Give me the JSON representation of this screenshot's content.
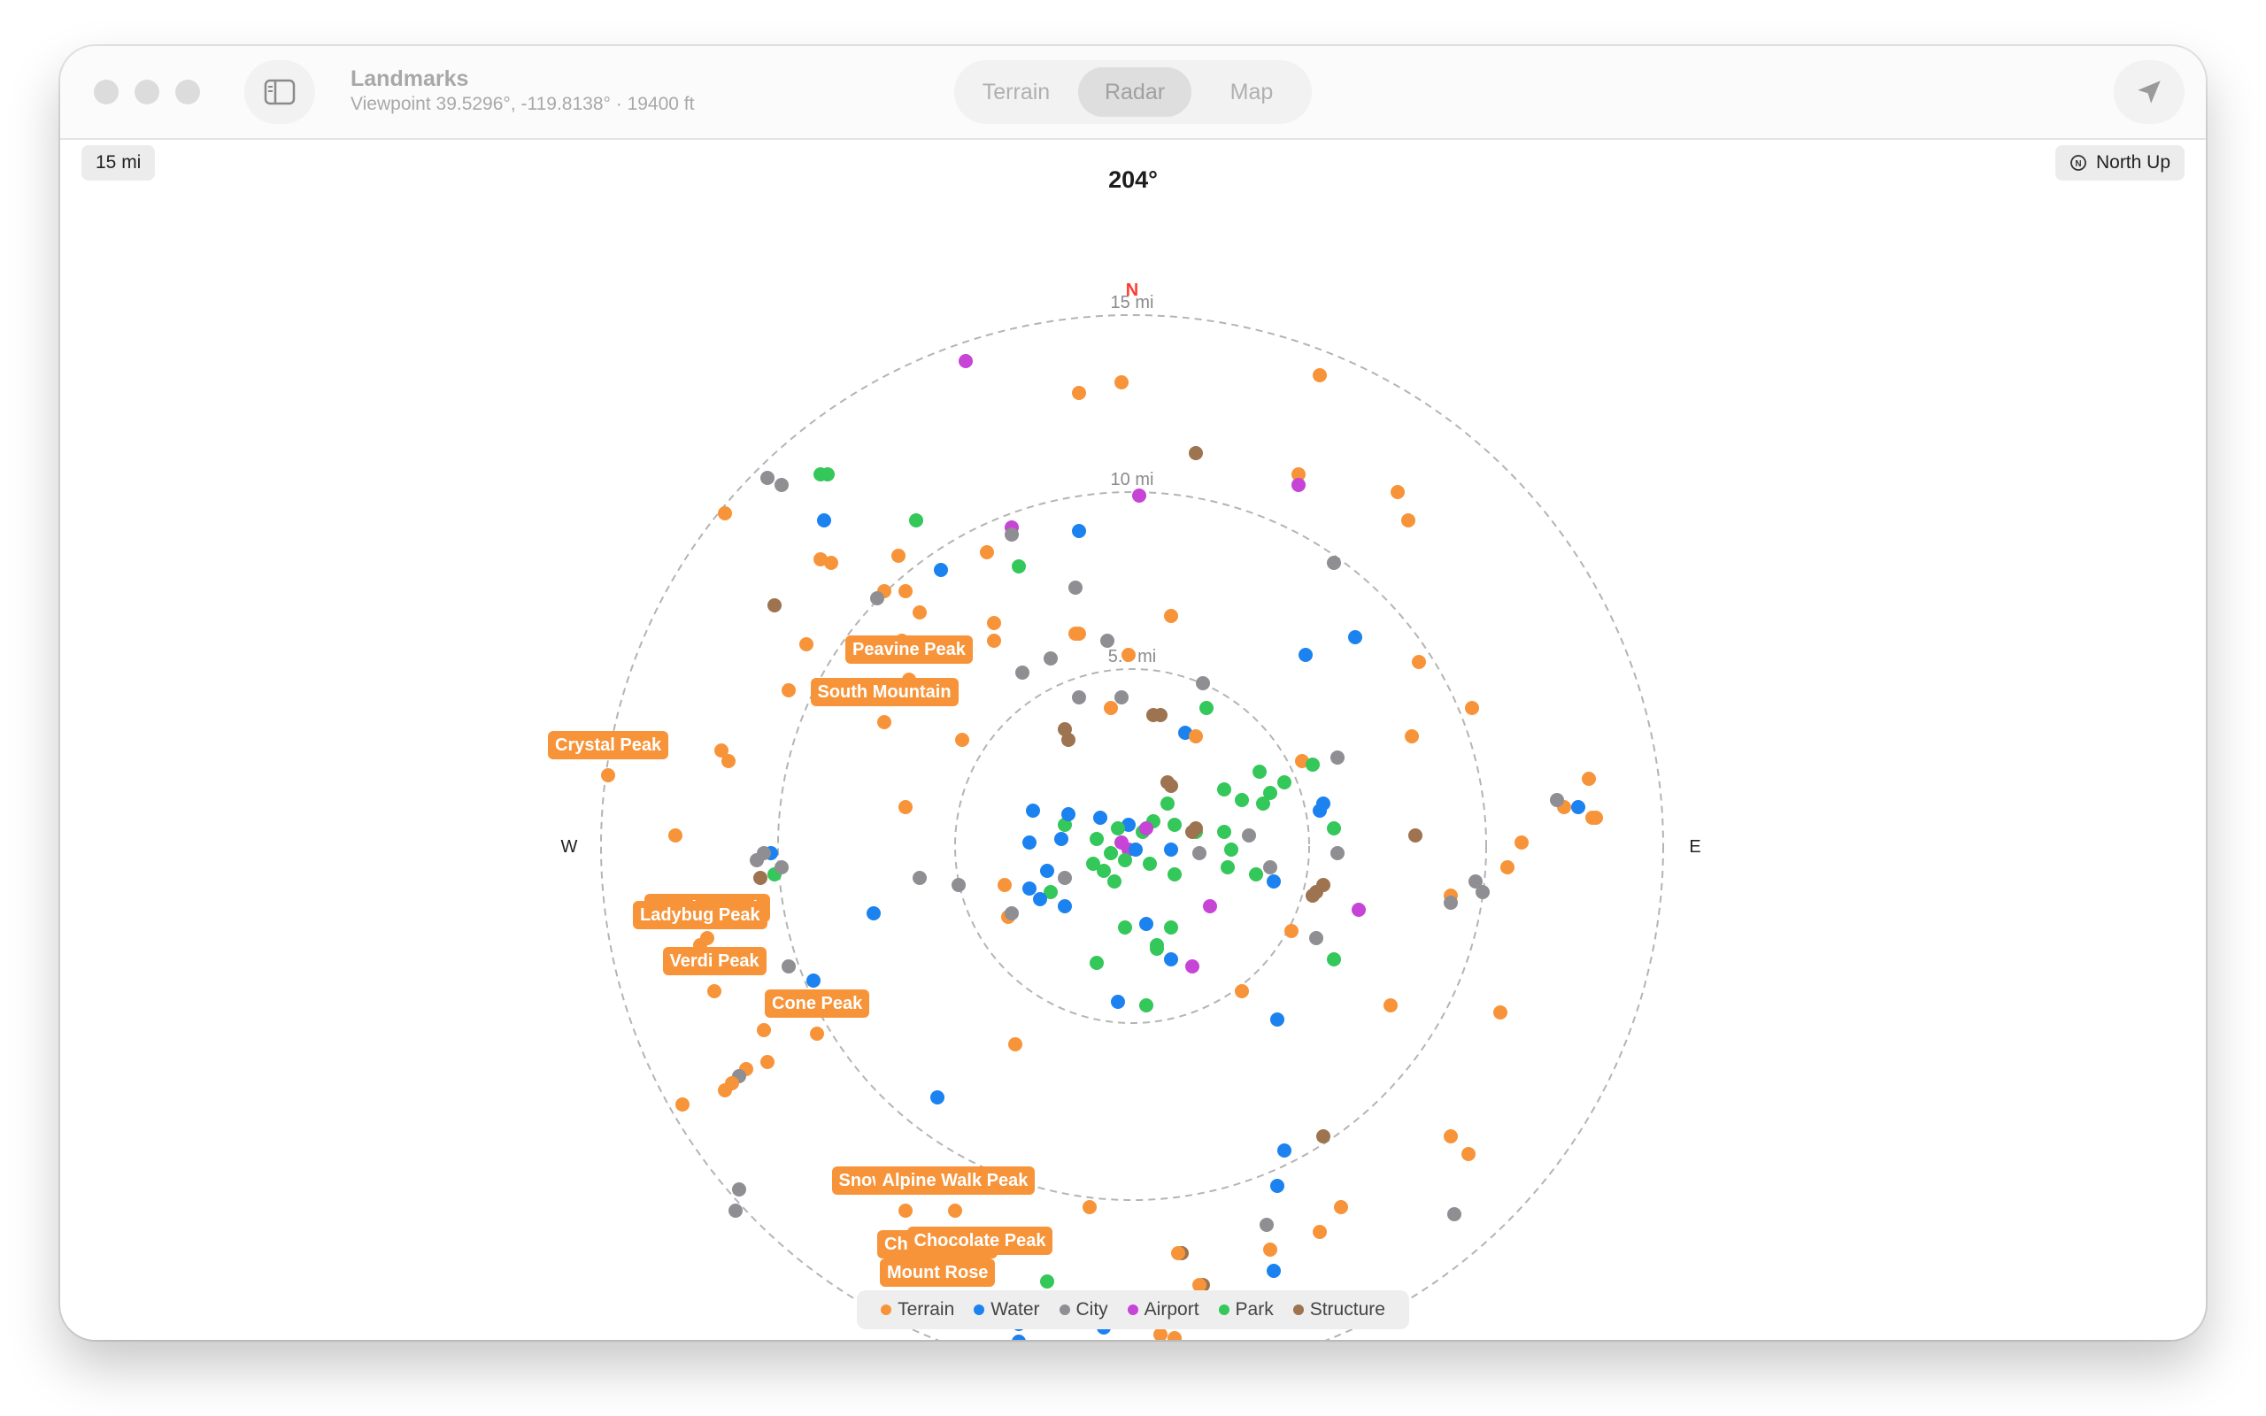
{
  "window": {
    "title": "Landmarks",
    "subtitle": "Viewpoint 39.5296°, -119.8138° · 19400 ft"
  },
  "view_modes": [
    {
      "label": "Terrain",
      "selected": false
    },
    {
      "label": "Radar",
      "selected": true
    },
    {
      "label": "Map",
      "selected": false
    }
  ],
  "toolbar": {
    "scale_label": "15 mi",
    "north_up_label": "North Up",
    "heading_label": "204°"
  },
  "radar": {
    "max_range_mi": 15,
    "rings": [
      {
        "range_mi": 5,
        "label": "5.0 mi"
      },
      {
        "range_mi": 10,
        "label": "10 mi"
      },
      {
        "range_mi": 15,
        "label": "15 mi"
      }
    ],
    "compass": {
      "north": "N",
      "west": "W",
      "east": "E"
    }
  },
  "categories": [
    {
      "key": "terrain",
      "label": "Terrain",
      "color": "#f7943a"
    },
    {
      "key": "water",
      "label": "Water",
      "color": "#1b82f0"
    },
    {
      "key": "city",
      "label": "City",
      "color": "#8e8e93"
    },
    {
      "key": "airport",
      "label": "Airport",
      "color": "#c644d6"
    },
    {
      "key": "park",
      "label": "Park",
      "color": "#34c759"
    },
    {
      "key": "structure",
      "label": "Structure",
      "color": "#9d7350"
    }
  ],
  "landmarks": [
    {
      "name": "Peavine Peak",
      "category": "terrain",
      "e": -6.3,
      "n": 4.7
    },
    {
      "name": "South Mountain",
      "category": "terrain",
      "e": -7.0,
      "n": 3.5
    },
    {
      "name": "Crystal Peak",
      "category": "terrain",
      "e": -14.8,
      "n": 2.0
    },
    {
      "name": "Sunrise Peak",
      "category": "terrain",
      "e": -12.0,
      "n": -2.6
    },
    {
      "name": "Ladybug Peak",
      "category": "terrain",
      "e": -12.2,
      "n": -2.8
    },
    {
      "name": "Verdi Peak",
      "category": "terrain",
      "e": -11.8,
      "n": -4.1
    },
    {
      "name": "Cone Peak",
      "category": "terrain",
      "e": -8.9,
      "n": -5.3
    },
    {
      "name": "Snowflake Peak",
      "category": "terrain",
      "e": -6.4,
      "n": -10.3
    },
    {
      "name": "Alpine Walk Peak",
      "category": "terrain",
      "e": -5.0,
      "n": -10.3
    },
    {
      "name": "Chutes Peak",
      "category": "terrain",
      "e": -5.5,
      "n": -12.1
    },
    {
      "name": "Chocolate Peak",
      "category": "terrain",
      "e": -4.3,
      "n": -12.0
    },
    {
      "name": "Mount Rose",
      "category": "terrain",
      "e": -5.5,
      "n": -12.9
    }
  ],
  "points": [
    {
      "category": "airport",
      "e": -4.7,
      "n": 13.7
    },
    {
      "category": "terrain",
      "e": -1.5,
      "n": 12.8
    },
    {
      "category": "terrain",
      "e": -0.3,
      "n": 13.1
    },
    {
      "category": "terrain",
      "e": 5.3,
      "n": 13.3
    },
    {
      "category": "structure",
      "e": 1.8,
      "n": 11.1
    },
    {
      "category": "city",
      "e": -10.3,
      "n": 10.4
    },
    {
      "category": "city",
      "e": -9.9,
      "n": 10.2
    },
    {
      "category": "park",
      "e": -8.8,
      "n": 10.5
    },
    {
      "category": "park",
      "e": -8.6,
      "n": 10.5
    },
    {
      "category": "terrain",
      "e": -11.5,
      "n": 9.4
    },
    {
      "category": "water",
      "e": -8.7,
      "n": 9.2
    },
    {
      "category": "park",
      "e": -6.1,
      "n": 9.2
    },
    {
      "category": "terrain",
      "e": 4.7,
      "n": 10.5
    },
    {
      "category": "airport",
      "e": 4.7,
      "n": 10.2
    },
    {
      "category": "terrain",
      "e": 7.5,
      "n": 10.0
    },
    {
      "category": "terrain",
      "e": 7.8,
      "n": 9.2
    },
    {
      "category": "airport",
      "e": 0.2,
      "n": 9.9
    },
    {
      "category": "airport",
      "e": -3.4,
      "n": 9.0
    },
    {
      "category": "city",
      "e": -3.4,
      "n": 8.8
    },
    {
      "category": "water",
      "e": -1.5,
      "n": 8.9
    },
    {
      "category": "terrain",
      "e": -8.8,
      "n": 8.1
    },
    {
      "category": "terrain",
      "e": -8.5,
      "n": 8.0
    },
    {
      "category": "terrain",
      "e": -6.6,
      "n": 8.2
    },
    {
      "category": "terrain",
      "e": -4.1,
      "n": 8.3
    },
    {
      "category": "water",
      "e": -5.4,
      "n": 7.8
    },
    {
      "category": "park",
      "e": -3.2,
      "n": 7.9
    },
    {
      "category": "city",
      "e": 5.7,
      "n": 8.0
    },
    {
      "category": "terrain",
      "e": -7.0,
      "n": 7.2
    },
    {
      "category": "city",
      "e": -7.2,
      "n": 7.0
    },
    {
      "category": "terrain",
      "e": -6.4,
      "n": 7.2
    },
    {
      "category": "city",
      "e": -1.6,
      "n": 7.3
    },
    {
      "category": "structure",
      "e": -10.1,
      "n": 6.8
    },
    {
      "category": "terrain",
      "e": -6.0,
      "n": 6.6
    },
    {
      "category": "terrain",
      "e": -3.9,
      "n": 6.3
    },
    {
      "category": "terrain",
      "e": 1.1,
      "n": 6.5
    },
    {
      "category": "terrain",
      "e": -9.2,
      "n": 5.7
    },
    {
      "category": "terrain",
      "e": -6.5,
      "n": 5.8
    },
    {
      "category": "terrain",
      "e": -6.3,
      "n": 5.6
    },
    {
      "category": "terrain",
      "e": -3.9,
      "n": 5.8
    },
    {
      "category": "terrain",
      "e": -1.6,
      "n": 6.0
    },
    {
      "category": "terrain",
      "e": -1.5,
      "n": 6.0
    },
    {
      "category": "city",
      "e": -0.7,
      "n": 5.8
    },
    {
      "category": "water",
      "e": 4.9,
      "n": 5.4
    },
    {
      "category": "water",
      "e": 6.3,
      "n": 5.9
    },
    {
      "category": "terrain",
      "e": 8.1,
      "n": 5.2
    },
    {
      "category": "city",
      "e": -2.3,
      "n": 5.3
    },
    {
      "category": "city",
      "e": -3.1,
      "n": 4.9
    },
    {
      "category": "terrain",
      "e": -0.1,
      "n": 5.4
    },
    {
      "category": "city",
      "e": 2.0,
      "n": 4.6
    },
    {
      "category": "terrain",
      "e": -9.7,
      "n": 4.4
    },
    {
      "category": "city",
      "e": -1.5,
      "n": 4.2
    },
    {
      "category": "city",
      "e": -0.3,
      "n": 4.2
    },
    {
      "category": "terrain",
      "e": -0.6,
      "n": 3.9
    },
    {
      "category": "park",
      "e": 2.1,
      "n": 3.9
    },
    {
      "category": "structure",
      "e": 0.6,
      "n": 3.7
    },
    {
      "category": "structure",
      "e": 0.8,
      "n": 3.7
    },
    {
      "category": "terrain",
      "e": 9.6,
      "n": 3.9
    },
    {
      "category": "structure",
      "e": -1.9,
      "n": 3.3
    },
    {
      "category": "structure",
      "e": -1.8,
      "n": 3.0
    },
    {
      "category": "water",
      "e": 1.5,
      "n": 3.2
    },
    {
      "category": "terrain",
      "e": 1.8,
      "n": 3.1
    },
    {
      "category": "terrain",
      "e": -4.8,
      "n": 3.0
    },
    {
      "category": "terrain",
      "e": 7.9,
      "n": 3.1
    },
    {
      "category": "terrain",
      "e": -11.6,
      "n": 2.7
    },
    {
      "category": "terrain",
      "e": -11.4,
      "n": 2.4
    },
    {
      "category": "city",
      "e": 5.8,
      "n": 2.5
    },
    {
      "category": "terrain",
      "e": 4.8,
      "n": 2.4
    },
    {
      "category": "park",
      "e": 5.1,
      "n": 2.3
    },
    {
      "category": "terrain",
      "e": 12.9,
      "n": 1.9
    },
    {
      "category": "water",
      "e": 12.6,
      "n": 1.1
    },
    {
      "category": "terrain",
      "e": 13.1,
      "n": 0.8
    },
    {
      "category": "terrain",
      "e": 12.2,
      "n": 1.1
    },
    {
      "category": "city",
      "e": 12.0,
      "n": 1.3
    },
    {
      "category": "terrain",
      "e": 13.0,
      "n": 0.8
    },
    {
      "category": "terrain",
      "e": 11.0,
      "n": 0.1
    },
    {
      "category": "terrain",
      "e": 10.6,
      "n": -0.6
    },
    {
      "category": "terrain",
      "e": -6.4,
      "n": 1.1
    },
    {
      "category": "terrain",
      "e": -12.9,
      "n": 0.3
    },
    {
      "category": "structure",
      "e": 8.0,
      "n": 0.3
    },
    {
      "category": "park",
      "e": -1.9,
      "n": 0.6
    },
    {
      "category": "water",
      "e": -2.8,
      "n": 1.0
    },
    {
      "category": "water",
      "e": -1.8,
      "n": 0.9
    },
    {
      "category": "water",
      "e": -0.9,
      "n": 0.8
    },
    {
      "category": "water",
      "e": -0.1,
      "n": 0.6
    },
    {
      "category": "park",
      "e": 1.0,
      "n": 1.2
    },
    {
      "category": "park",
      "e": 2.6,
      "n": 1.6
    },
    {
      "category": "park",
      "e": 3.1,
      "n": 1.3
    },
    {
      "category": "park",
      "e": 3.9,
      "n": 1.5
    },
    {
      "category": "park",
      "e": 4.3,
      "n": 1.8
    },
    {
      "category": "park",
      "e": 3.6,
      "n": 2.1
    },
    {
      "category": "park",
      "e": 3.7,
      "n": 1.2
    },
    {
      "category": "structure",
      "e": 1.0,
      "n": 1.8
    },
    {
      "category": "structure",
      "e": 1.1,
      "n": 1.7
    },
    {
      "category": "water",
      "e": 5.4,
      "n": 1.2
    },
    {
      "category": "water",
      "e": 5.3,
      "n": 1.0
    },
    {
      "category": "water",
      "e": -2.9,
      "n": 0.1
    },
    {
      "category": "water",
      "e": -2.0,
      "n": 0.2
    },
    {
      "category": "park",
      "e": -1.0,
      "n": 0.2
    },
    {
      "category": "park",
      "e": -0.4,
      "n": 0.5
    },
    {
      "category": "park",
      "e": 0.3,
      "n": 0.4
    },
    {
      "category": "park",
      "e": 0.6,
      "n": 0.7
    },
    {
      "category": "park",
      "e": 1.2,
      "n": 0.6
    },
    {
      "category": "park",
      "e": 1.8,
      "n": 0.4
    },
    {
      "category": "park",
      "e": 2.6,
      "n": 0.4
    },
    {
      "category": "city",
      "e": 3.3,
      "n": 0.3
    },
    {
      "category": "structure",
      "e": 1.7,
      "n": 0.4
    },
    {
      "category": "structure",
      "e": 1.8,
      "n": 0.5
    },
    {
      "category": "airport",
      "e": -0.3,
      "n": 0.1
    },
    {
      "category": "airport",
      "e": -0.1,
      "n": -0.1
    },
    {
      "category": "airport",
      "e": 0.4,
      "n": 0.5
    },
    {
      "category": "water",
      "e": 0.1,
      "n": -0.1
    },
    {
      "category": "park",
      "e": -0.6,
      "n": -0.2
    },
    {
      "category": "park",
      "e": -0.2,
      "n": -0.4
    },
    {
      "category": "park",
      "e": 0.5,
      "n": -0.5
    },
    {
      "category": "park",
      "e": -1.1,
      "n": -0.5
    },
    {
      "category": "water",
      "e": 1.1,
      "n": -0.1
    },
    {
      "category": "city",
      "e": 1.9,
      "n": -0.2
    },
    {
      "category": "park",
      "e": 2.8,
      "n": -0.1
    },
    {
      "category": "park",
      "e": 5.7,
      "n": 0.5
    },
    {
      "category": "city",
      "e": 5.8,
      "n": -0.2
    },
    {
      "category": "park",
      "e": -10.1,
      "n": -0.8
    },
    {
      "category": "water",
      "e": -10.2,
      "n": -0.2
    },
    {
      "category": "city",
      "e": -10.6,
      "n": -0.4
    },
    {
      "category": "city",
      "e": -10.4,
      "n": -0.2
    },
    {
      "category": "city",
      "e": -9.9,
      "n": -0.6
    },
    {
      "category": "structure",
      "e": -10.5,
      "n": -0.9
    },
    {
      "category": "city",
      "e": -6.0,
      "n": -0.9
    },
    {
      "category": "city",
      "e": -4.9,
      "n": -1.1
    },
    {
      "category": "terrain",
      "e": -3.6,
      "n": -1.1
    },
    {
      "category": "water",
      "e": -2.4,
      "n": -0.7
    },
    {
      "category": "city",
      "e": -1.9,
      "n": -0.9
    },
    {
      "category": "park",
      "e": -0.8,
      "n": -0.7
    },
    {
      "category": "park",
      "e": -0.5,
      "n": -1.0
    },
    {
      "category": "park",
      "e": 1.2,
      "n": -0.8
    },
    {
      "category": "park",
      "e": 2.7,
      "n": -0.6
    },
    {
      "category": "park",
      "e": 3.5,
      "n": -0.8
    },
    {
      "category": "city",
      "e": 3.9,
      "n": -0.6
    },
    {
      "category": "water",
      "e": 4.0,
      "n": -1.0
    },
    {
      "category": "structure",
      "e": 5.4,
      "n": -1.1
    },
    {
      "category": "structure",
      "e": 5.2,
      "n": -1.3
    },
    {
      "category": "structure",
      "e": 5.1,
      "n": -1.4
    },
    {
      "category": "water",
      "e": -2.9,
      "n": -1.2
    },
    {
      "category": "park",
      "e": -2.3,
      "n": -1.3
    },
    {
      "category": "water",
      "e": -2.6,
      "n": -1.5
    },
    {
      "category": "water",
      "e": -1.9,
      "n": -1.7
    },
    {
      "category": "airport",
      "e": 2.2,
      "n": -1.7
    },
    {
      "category": "airport",
      "e": 6.4,
      "n": -1.8
    },
    {
      "category": "terrain",
      "e": 9.0,
      "n": -1.4
    },
    {
      "category": "city",
      "e": 9.0,
      "n": -1.6
    },
    {
      "category": "city",
      "e": 9.9,
      "n": -1.3
    },
    {
      "category": "city",
      "e": 9.7,
      "n": -1.0
    },
    {
      "category": "terrain",
      "e": -3.5,
      "n": -2.0
    },
    {
      "category": "city",
      "e": -3.4,
      "n": -1.9
    },
    {
      "category": "water",
      "e": -7.3,
      "n": -1.9
    },
    {
      "category": "water",
      "e": 0.4,
      "n": -2.2
    },
    {
      "category": "park",
      "e": -0.2,
      "n": -2.3
    },
    {
      "category": "park",
      "e": 1.1,
      "n": -2.3
    },
    {
      "category": "terrain",
      "e": 4.5,
      "n": -2.4
    },
    {
      "category": "city",
      "e": 5.2,
      "n": -2.6
    },
    {
      "category": "park",
      "e": 0.7,
      "n": -2.8
    },
    {
      "category": "park",
      "e": 0.7,
      "n": -2.9
    },
    {
      "category": "water",
      "e": 1.1,
      "n": -3.2
    },
    {
      "category": "airport",
      "e": 1.7,
      "n": -3.4
    },
    {
      "category": "park",
      "e": -1.0,
      "n": -3.3
    },
    {
      "category": "park",
      "e": 5.7,
      "n": -3.2
    },
    {
      "category": "city",
      "e": -9.7,
      "n": -3.4
    },
    {
      "category": "water",
      "e": -9.0,
      "n": -3.8
    },
    {
      "category": "terrain",
      "e": 3.1,
      "n": -4.1
    },
    {
      "category": "water",
      "e": -0.4,
      "n": -4.4
    },
    {
      "category": "park",
      "e": 0.4,
      "n": -4.5
    },
    {
      "category": "water",
      "e": 4.1,
      "n": -4.9
    },
    {
      "category": "terrain",
      "e": 7.3,
      "n": -4.5
    },
    {
      "category": "terrain",
      "e": 10.4,
      "n": -4.7
    },
    {
      "category": "terrain",
      "e": -10.4,
      "n": -5.2
    },
    {
      "category": "terrain",
      "e": -3.3,
      "n": -5.6
    },
    {
      "category": "terrain",
      "e": -10.3,
      "n": -6.1
    },
    {
      "category": "terrain",
      "e": -10.9,
      "n": -6.3
    },
    {
      "category": "city",
      "e": -11.1,
      "n": -6.5
    },
    {
      "category": "terrain",
      "e": -11.3,
      "n": -6.7
    },
    {
      "category": "terrain",
      "e": -11.5,
      "n": -6.9
    },
    {
      "category": "terrain",
      "e": -12.7,
      "n": -7.3
    },
    {
      "category": "water",
      "e": -5.5,
      "n": -7.1
    },
    {
      "category": "structure",
      "e": 5.4,
      "n": -8.2
    },
    {
      "category": "water",
      "e": 4.3,
      "n": -8.6
    },
    {
      "category": "terrain",
      "e": 9.0,
      "n": -8.2
    },
    {
      "category": "terrain",
      "e": 9.5,
      "n": -8.7
    },
    {
      "category": "water",
      "e": 4.1,
      "n": -9.6
    },
    {
      "category": "city",
      "e": -11.1,
      "n": -9.7
    },
    {
      "category": "city",
      "e": -11.2,
      "n": -10.3
    },
    {
      "category": "terrain",
      "e": -1.2,
      "n": -10.2
    },
    {
      "category": "terrain",
      "e": 5.9,
      "n": -10.2
    },
    {
      "category": "city",
      "e": 3.8,
      "n": -10.7
    },
    {
      "category": "terrain",
      "e": 5.3,
      "n": -10.9
    },
    {
      "category": "city",
      "e": 9.1,
      "n": -10.4
    },
    {
      "category": "terrain",
      "e": 3.9,
      "n": -11.4
    },
    {
      "category": "structure",
      "e": 1.4,
      "n": -11.5
    },
    {
      "category": "terrain",
      "e": 1.3,
      "n": -11.5
    },
    {
      "category": "water",
      "e": 4.0,
      "n": -12.0
    },
    {
      "category": "park",
      "e": -2.4,
      "n": -12.3
    },
    {
      "category": "structure",
      "e": 2.0,
      "n": -12.4
    },
    {
      "category": "terrain",
      "e": 1.9,
      "n": -12.4
    },
    {
      "category": "water",
      "e": -3.2,
      "n": -13.5
    },
    {
      "category": "water",
      "e": -0.8,
      "n": -13.6
    },
    {
      "category": "water",
      "e": -3.2,
      "n": -14.0
    },
    {
      "category": "terrain",
      "e": 0.8,
      "n": -13.8
    },
    {
      "category": "terrain",
      "e": 1.2,
      "n": -13.9
    }
  ]
}
